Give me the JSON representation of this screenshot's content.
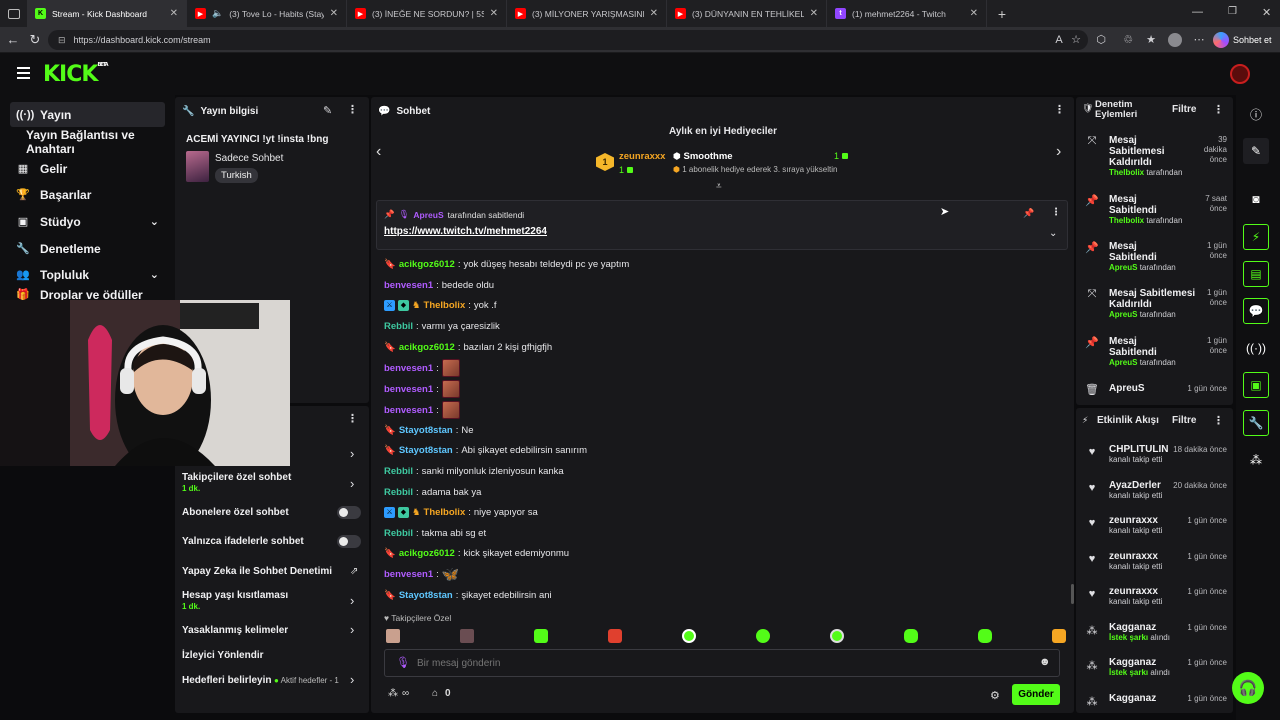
{
  "browser": {
    "tabs": [
      {
        "title": "Stream - Kick Dashboard",
        "active": true,
        "icon": "kick-icon"
      },
      {
        "title": "(3) Tove Lo - Habits (Stay Hig",
        "icon": "youtube-icon"
      },
      {
        "title": "(3) İNEĞE NE SORDUN? | 5Sriders",
        "icon": "youtube-icon"
      },
      {
        "title": "(3) MİLYONER YARIŞMASINI DOLA",
        "icon": "youtube-icon"
      },
      {
        "title": "(3) DÜNYANIN EN TEHLİKELİ TREN",
        "icon": "youtube-icon"
      },
      {
        "title": "(1) mehmet2264 - Twitch",
        "icon": "twitch-icon"
      }
    ],
    "url": "https://dashboard.kick.com/stream",
    "profile_label": "Sohbet et"
  },
  "app": {
    "logo": "KICK",
    "logo_sup": "BETA"
  },
  "leftnav": {
    "items": [
      {
        "label": "Yayın",
        "icon": "broadcast-icon"
      },
      {
        "label": "Yayın Bağlantısı ve Anahtarı"
      },
      {
        "label": "Gelir",
        "icon": "chart-icon"
      },
      {
        "label": "Başarılar",
        "icon": "trophy-icon"
      },
      {
        "label": "Stüdyo",
        "icon": "studio-icon"
      },
      {
        "label": "Denetleme",
        "icon": "wrench-icon"
      },
      {
        "label": "Topluluk",
        "icon": "people-icon"
      },
      {
        "label": "Droplar ve ödüller"
      }
    ]
  },
  "stream_info": {
    "header": "Yayın bilgisi",
    "title": "ACEMİ YAYINCI !yt !insta !bng",
    "category": "Sadece Sohbet",
    "language": "Turkish"
  },
  "chat_settings": {
    "followers_only": "Takipçilere özel sohbet",
    "followers_only_value": "1 dk.",
    "subscribers_only": "Abonelere özel sohbet",
    "emotes_only": "Yalnızca ifadelerle sohbet",
    "ai_moderation": "Yapay Zeka ile Sohbet Denetimi",
    "account_age": "Hesap yaşı kısıtlaması",
    "account_age_value": "1 dk.",
    "banned_words": "Yasaklanmış kelimeler",
    "viewer_redirect": "İzleyici Yönlendir",
    "goals": "Hedefleri belirleyin",
    "goals_status": "Aktif hedefler - 1"
  },
  "chat": {
    "header": "Sohbet",
    "top_gifters_title": "Aylık en iyi Hediyeciler",
    "gifter1_name": "zeunraxxx",
    "gifter1_count": "1",
    "gifter2_name": "Smoothme",
    "gifter2_count": "1",
    "gifter2_note": "1 abonelik hediye ederek 3. sıraya yükseltin",
    "pinned_by_user": "ApreuS",
    "pinned_by_text": "tarafından sabitlendi",
    "pinned_link": "https://www.twitch.tv/mehmet2264",
    "messages": [
      {
        "user": "acikgoz6012",
        "text": "yok düşeş hesabı teldeydi pc ye yaptım",
        "color": "#53fc18"
      },
      {
        "user": "benvesen1",
        "text": "bedede oldu",
        "color": "#b05cff"
      },
      {
        "user": "TheIbolix",
        "text": "yok .f",
        "color": "#f5a623"
      },
      {
        "user": "Rebbil",
        "text": "varmı ya çaresizlik",
        "color": "#3ec8a0"
      },
      {
        "user": "acikgoz6012",
        "text": "bazıları 2 kişi gfhjgfjh",
        "color": "#53fc18"
      },
      {
        "user": "benvesen1",
        "text": "",
        "color": "#b05cff"
      },
      {
        "user": "benvesen1",
        "text": "",
        "color": "#b05cff"
      },
      {
        "user": "benvesen1",
        "text": "",
        "color": "#b05cff"
      },
      {
        "user": "Stayot8stan",
        "text": "Ne",
        "color": "#5fc7ff"
      },
      {
        "user": "Stayot8stan",
        "text": "Abi şikayet edebilirsin sanırım",
        "color": "#5fc7ff"
      },
      {
        "user": "Rebbil",
        "text": "sanki milyonluk izleniyosun kanka",
        "color": "#3ec8a0"
      },
      {
        "user": "Rebbil",
        "text": "adama bak ya",
        "color": "#3ec8a0"
      },
      {
        "user": "TheIbolix",
        "text": "niye yapıyor sa",
        "color": "#f5a623"
      },
      {
        "user": "Rebbil",
        "text": "takma abi sg et",
        "color": "#3ec8a0"
      },
      {
        "user": "acikgoz6012",
        "text": "kick şikayet edemiyonmu",
        "color": "#53fc18"
      },
      {
        "user": "benvesen1",
        "text": "",
        "color": "#b05cff"
      },
      {
        "user": "Stayot8stan",
        "text": "şikayet edebilirsin ani",
        "color": "#5fc7ff"
      }
    ],
    "followers_label": "Takipçilere Özel",
    "input_placeholder": "Bir mesaj gönderin",
    "points": "∞",
    "store_count": "0",
    "send_label": "Gönder"
  },
  "mod_actions": {
    "header": "Denetim Eylemleri",
    "filter": "Filtre",
    "items": [
      {
        "title": "Mesaj Sabitlemesi Kaldırıldı",
        "by": "TheIbolix",
        "suffix": "tarafından",
        "time": "39 dakika önce"
      },
      {
        "title": "Mesaj Sabitlendi",
        "by": "TheIbolix",
        "suffix": "tarafından",
        "time": "7 saat önce"
      },
      {
        "title": "Mesaj Sabitlendi",
        "by": "ApreuS",
        "suffix": "tarafından",
        "time": "1 gün önce"
      },
      {
        "title": "Mesaj Sabitlemesi Kaldırıldı",
        "by": "ApreuS",
        "suffix": "tarafından",
        "time": "1 gün önce"
      },
      {
        "title": "Mesaj Sabitlendi",
        "by": "ApreuS",
        "suffix": "tarafından",
        "time": "1 gün önce"
      },
      {
        "title": "ApreuS",
        "by": "",
        "suffix": "",
        "time": "1 gün önce"
      }
    ]
  },
  "activity": {
    "header": "Etkinlik Akışı",
    "filter": "Filtre",
    "items": [
      {
        "name": "CHPLITULIN",
        "sub": "kanalı takip etti",
        "time": "18 dakika önce"
      },
      {
        "name": "AyazDerler",
        "sub": "kanalı takip etti",
        "time": "20 dakika önce"
      },
      {
        "name": "zeunraxxx",
        "sub": "kanalı takip etti",
        "time": "1 gün önce"
      },
      {
        "name": "zeunraxxx",
        "sub": "kanalı takip etti",
        "time": "1 gün önce"
      },
      {
        "name": "zeunraxxx",
        "sub": "kanalı takip etti",
        "time": "1 gün önce"
      },
      {
        "name": "Kagganaz",
        "hl": "İstek şarkı",
        "sub": "alındı",
        "time": "1 gün önce"
      },
      {
        "name": "Kagganaz",
        "hl": "İstek şarkı",
        "sub": "alındı",
        "time": "1 gün önce"
      },
      {
        "name": "Kagganaz",
        "hl": "",
        "sub": "",
        "time": "1 gün önce"
      }
    ]
  },
  "colors": {
    "accent": "#53fc18",
    "panel": "#18181b",
    "bg": "#0b0b0d"
  }
}
